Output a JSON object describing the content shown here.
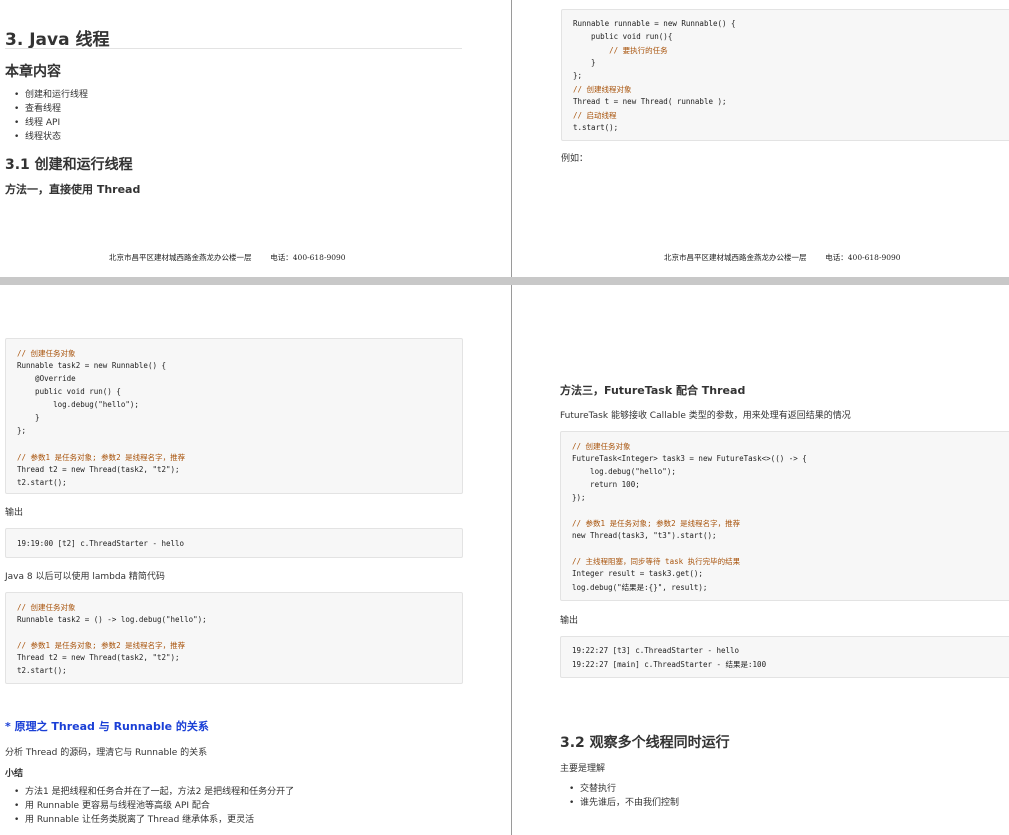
{
  "page1": {
    "chapter_title": "3. Java 线程",
    "contents_heading": "本章内容",
    "contents_items": [
      "创建和运行线程",
      "查看线程",
      "线程 API",
      "线程状态"
    ],
    "section_heading": "3.1 创建和运行线程",
    "method1_heading": "方法一，直接使用 Thread",
    "footer_address": "北京市昌平区建材城西路金燕龙办公楼一层",
    "footer_phone": "电话：400-618-9090"
  },
  "page2": {
    "code_lines": [
      "Runnable runnable = new Runnable() {",
      "    public void run(){",
      "        // 要执行的任务",
      "    }",
      "};",
      "// 创建线程对象",
      "Thread t = new Thread( runnable );",
      "// 启动线程",
      "t.start();"
    ],
    "example_label": "例如：",
    "footer_address": "北京市昌平区建材城西路金燕龙办公楼一层",
    "footer_phone": "电话：400-618-9090"
  },
  "page3": {
    "code1_lines": [
      "// 创建任务对象",
      "Runnable task2 = new Runnable() {",
      "    @Override",
      "    public void run() {",
      "        log.debug(\"hello\");",
      "    }",
      "};",
      "",
      "// 参数1 是任务对象; 参数2 是线程名字，推荐",
      "Thread t2 = new Thread(task2, \"t2\");",
      "t2.start();"
    ],
    "output_label": "输出",
    "output_lines": [
      "19:19:00 [t2] c.ThreadStarter - hello"
    ],
    "lambda_note": "Java 8 以后可以使用 lambda 精简代码",
    "code2_lines": [
      "// 创建任务对象",
      "Runnable task2 = () -> log.debug(\"hello\");",
      "",
      "// 参数1 是任务对象; 参数2 是线程名字，推荐",
      "Thread t2 = new Thread(task2, \"t2\");",
      "t2.start();"
    ],
    "principle_heading": "* 原理之 Thread 与 Runnable 的关系",
    "principle_text": "分析 Thread 的源码，理清它与 Runnable 的关系",
    "summary_heading": "小结",
    "summary_items": [
      "方法1 是把线程和任务合并在了一起，方法2 是把线程和任务分开了",
      "用 Runnable 更容易与线程池等高级 API 配合",
      "用 Runnable 让任务类脱离了 Thread 继承体系，更灵活"
    ]
  },
  "page4": {
    "method3_heading": "方法三，FutureTask 配合 Thread",
    "method3_desc": "FutureTask 能够接收 Callable 类型的参数，用来处理有返回结果的情况",
    "code_lines": [
      "// 创建任务对象",
      "FutureTask<Integer> task3 = new FutureTask<>(() -> {",
      "    log.debug(\"hello\");",
      "    return 100;",
      "});",
      "",
      "// 参数1 是任务对象; 参数2 是线程名字，推荐",
      "new Thread(task3, \"t3\").start();",
      "",
      "// 主线程阻塞，同步等待 task 执行完毕的结果",
      "Integer result = task3.get();",
      "log.debug(\"结果是:{}\", result);"
    ],
    "output_label": "输出",
    "output_lines": [
      "19:22:27 [t3] c.ThreadStarter - hello",
      "19:22:27 [main] c.ThreadStarter - 结果是:100"
    ],
    "section_heading": "3.2 观察多个线程同时运行",
    "section_desc": "主要是理解",
    "section_items": [
      "交替执行",
      "谁先谁后，不由我们控制"
    ]
  },
  "colors": {
    "page_gap": "#c8c8c8",
    "principle_heading": "#1a3fd6",
    "comment": "#a8530b",
    "keyword": "#7b1fa2",
    "string": "#a11"
  }
}
